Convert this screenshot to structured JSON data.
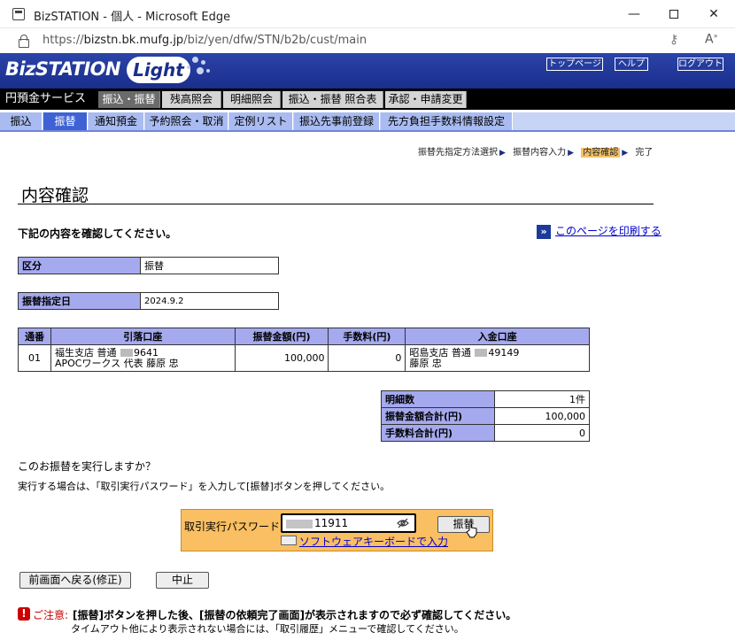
{
  "window": {
    "title": "BizSTATION - 個人 - Microsoft Edge",
    "minimize": "—",
    "close": "✕"
  },
  "address": {
    "url_prefix": "https://",
    "url_domain": "bizstn.bk.mufg.jp",
    "url_path": "/biz/yen/dfw/STN/b2b/cust/main"
  },
  "header": {
    "logo_main": "BizSTATION",
    "logo_sub": "Light",
    "links": [
      "トップページ",
      "ヘルプ",
      "ログアウト"
    ]
  },
  "main_nav": {
    "service": "円預金サービス",
    "items": [
      "振込・振替",
      "残高照会",
      "明細照会",
      "振込・振替 照合表",
      "承認・申請変更"
    ]
  },
  "sub_nav": {
    "items": [
      "振込",
      "振替",
      "通知預金",
      "予約照会・取消",
      "定例リスト",
      "振込先事前登録",
      "先方負担手数料情報設定"
    ]
  },
  "steps": [
    "振替先指定方法選択",
    "振替内容入力",
    "内容確認",
    "完了"
  ],
  "page": {
    "title": "内容確認",
    "lead": "下記の内容を確認してください。",
    "print_link": "このページを印刷する",
    "print_icon": "»"
  },
  "kubun": {
    "label": "区分",
    "value": "振替"
  },
  "transfer_date": {
    "label": "振替指定日",
    "value": "2024.9.2"
  },
  "detail_table": {
    "headers": [
      "通番",
      "引落口座",
      "振替金額(円)",
      "手数料(円)",
      "入金口座"
    ],
    "row": {
      "no": "01",
      "from_line1_a": "福生支店 普通 ",
      "from_line1_b": "9641",
      "from_line2": "APOCワークス 代表 藤原 忠",
      "amount": "100,000",
      "fee": "0",
      "to_line1_a": "昭島支店 普通 ",
      "to_line1_b": "49149",
      "to_line2": "藤原 忠"
    }
  },
  "summary": {
    "rows": [
      {
        "label": "明細数",
        "value": "1件"
      },
      {
        "label": "振替金額合計(円)",
        "value": "100,000"
      },
      {
        "label": "手数料合計(円)",
        "value": "0"
      }
    ]
  },
  "confirm": {
    "question": "このお振替を実行しますか？",
    "instruction": "実行する場合は、「取引実行パスワード」を入力して[振替]ボタンを押してください。"
  },
  "password": {
    "label": "取引実行パスワード",
    "value_visible": "11911",
    "exec_button": "振替",
    "keyboard_link": "ソフトウェアキーボードで入力"
  },
  "buttons": {
    "back": "前画面へ戻る(修正)",
    "cancel": "中止"
  },
  "notice": {
    "icon": "!",
    "label": "ご注意:",
    "text": "[振替]ボタンを押した後、[振替の依頼完了画面]が表示されますので必ず確認してください。",
    "sub": "タイムアウト他により表示されない場合には、「取引履歴」メニューで確認してください。"
  }
}
